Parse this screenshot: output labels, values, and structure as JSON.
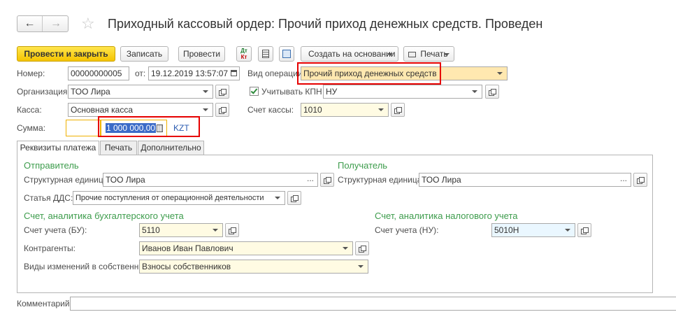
{
  "header": {
    "title": "Приходный кассовый ордер: Прочий приход денежных средств. Проведен"
  },
  "toolbar": {
    "post_close": "Провести и закрыть",
    "save": "Записать",
    "post": "Провести",
    "dtkt_top": "Дт",
    "dtkt_bottom": "Кт",
    "create_based": "Создать на основании",
    "print": "Печать"
  },
  "form": {
    "number_label": "Номер:",
    "number_value": "00000000005",
    "date_label": "от:",
    "date_value": "19.12.2019 13:57:07",
    "op_type_label": "Вид операции:",
    "op_type_value": "Прочий приход денежных средств",
    "org_label": "Организация:",
    "org_value": "ТОО Лира",
    "kpn_label": "Учитывать КПН",
    "kpn_value": "НУ",
    "cash_label": "Касса:",
    "cash_value": "Основная касса",
    "cash_account_label": "Счет кассы:",
    "cash_account_value": "1010",
    "sum_label": "Сумма:",
    "sum_value": "1 000 000,00",
    "currency": "KZT"
  },
  "tabs": [
    "Реквизиты платежа",
    "Печать",
    "Дополнительно"
  ],
  "payment": {
    "sender_title": "Отправитель",
    "sender_unit_label": "Структурная единица:",
    "sender_unit_value": "ТОО Лира",
    "dds_label": "Статья ДДС:",
    "dds_value": "Прочие поступления от операционной деятельности",
    "receiver_title": "Получатель",
    "receiver_unit_label": "Структурная единица:",
    "receiver_unit_value": "ТОО Лира",
    "bu_title": "Счет, аналитика бухгалтерского учета",
    "bu_account_label": "Счет учета (БУ):",
    "bu_account_value": "5110",
    "contractors_label": "Контрагенты:",
    "contractors_value": "Иванов Иван Павлович",
    "equity_label": "Виды изменений в собственн...:",
    "equity_value": "Взносы собственников",
    "nu_title": "Счет, аналитика налогового учета",
    "nu_account_label": "Счет учета (НУ):",
    "nu_account_value": "5010Н"
  },
  "comment_label": "Комментарий:",
  "ellipsis": "...",
  "colors": {
    "accent_yellow": "#f5c400",
    "highlight_red": "#e60000",
    "group_green": "#3d9c4c"
  }
}
